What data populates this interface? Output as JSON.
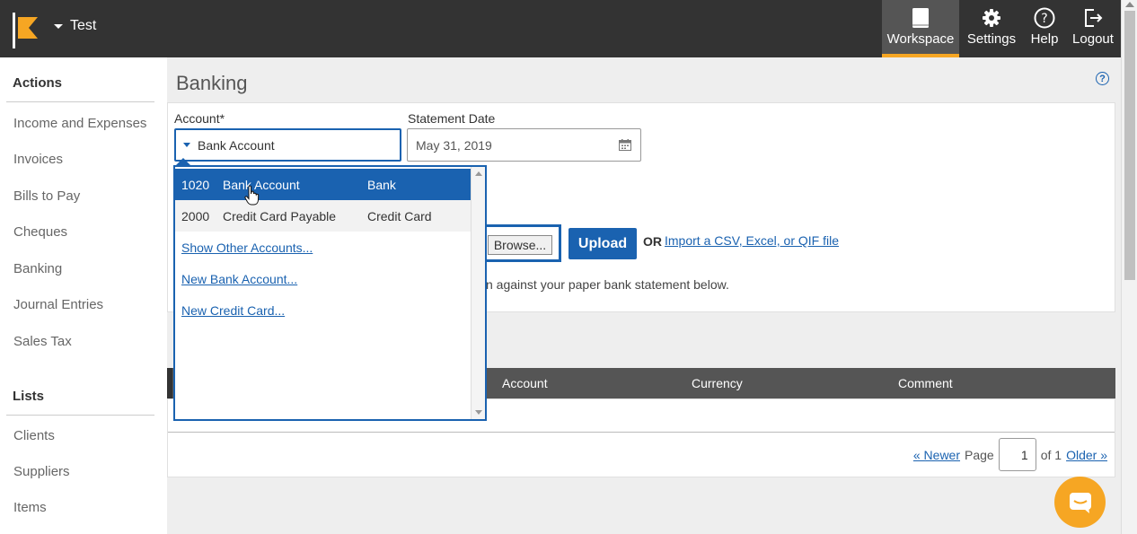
{
  "header": {
    "company": "Test",
    "nav": [
      {
        "label": "Workspace",
        "icon": "book-icon"
      },
      {
        "label": "Settings",
        "icon": "gear-icon"
      },
      {
        "label": "Help",
        "icon": "question-circle-icon"
      },
      {
        "label": "Logout",
        "icon": "logout-icon"
      }
    ]
  },
  "sidebar": {
    "actions_title": "Actions",
    "actions": [
      "Income and Expenses",
      "Invoices",
      "Bills to Pay",
      "Cheques",
      "Banking",
      "Journal Entries",
      "Sales Tax"
    ],
    "lists_title": "Lists",
    "lists": [
      "Clients",
      "Suppliers",
      "Items"
    ]
  },
  "page": {
    "title": "Banking",
    "help": "?",
    "account_label": "Account*",
    "account_value": "Bank Account",
    "statement_date_label": "Statement Date",
    "statement_date_value": "May 31, 2019",
    "browse_label": "Browse...",
    "upload_label": "Upload",
    "or_label": "OR",
    "import_link": "Import a CSV, Excel, or QIF file",
    "instructions_partial": "n against your paper bank statement below."
  },
  "table": {
    "columns": [
      "Account",
      "Currency",
      "Comment"
    ],
    "pager": {
      "newer": "« Newer",
      "page_label": "Page",
      "page_value": "1",
      "of_label": "of 1",
      "older": "Older »"
    }
  },
  "dropdown": {
    "options": [
      {
        "number": "1020",
        "name": "Bank Account",
        "type": "Bank",
        "selected": true
      },
      {
        "number": "2000",
        "name": "Credit Card Payable",
        "type": "Credit Card",
        "selected": false
      }
    ],
    "links": [
      "Show Other Accounts...",
      "New Bank Account...",
      "New Credit Card..."
    ]
  },
  "colors": {
    "accent": "#1a62b0",
    "brand": "#f6a623",
    "topbar": "#333333"
  }
}
